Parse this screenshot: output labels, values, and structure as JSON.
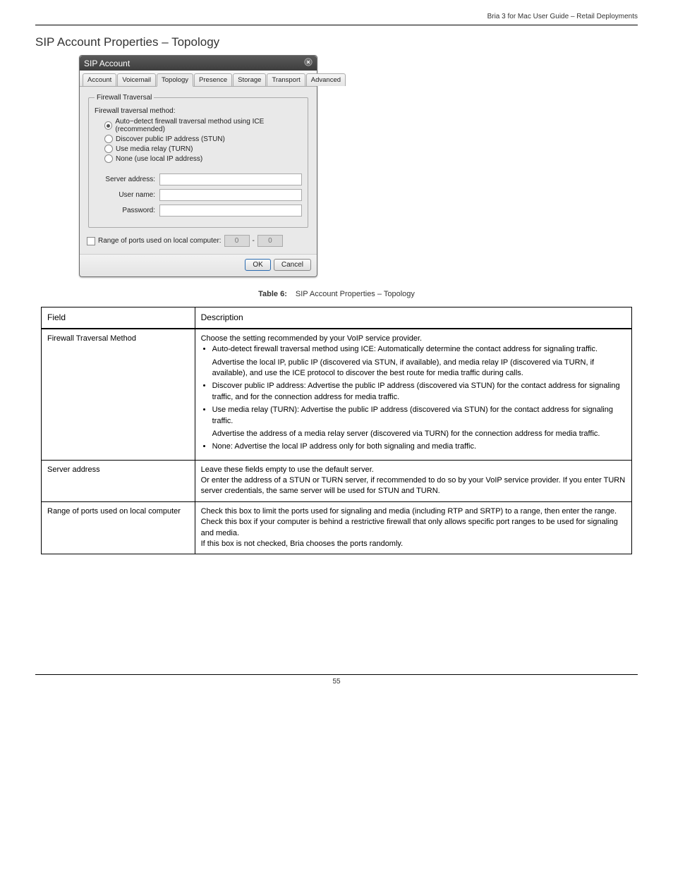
{
  "header": {
    "product": "Bria 3 for Mac User Guide – Retail Deployments"
  },
  "section": {
    "title": "SIP Account Properties – Topology"
  },
  "dialog": {
    "title": "SIP Account",
    "tabs": [
      "Account",
      "Voicemail",
      "Topology",
      "Presence",
      "Storage",
      "Transport",
      "Advanced"
    ],
    "active_tab": "Topology",
    "fieldset_legend": "Firewall Traversal",
    "method_label": "Firewall traversal method:",
    "options": [
      "Auto−detect firewall traversal method using ICE (recommended)",
      "Discover public IP address (STUN)",
      "Use media relay (TURN)",
      "None (use local IP address)"
    ],
    "labels": {
      "server": "Server address:",
      "username": "User name:",
      "password": "Password:"
    },
    "ports_label": "Range of ports used on local computer:",
    "port_from": "0",
    "port_to": "0",
    "ok": "OK",
    "cancel": "Cancel",
    "dash": "-"
  },
  "table": {
    "caption_label": "Table 6:",
    "caption_title": "SIP Account Properties – Topology",
    "columns": [
      "Field",
      "Description"
    ],
    "rows": [
      {
        "field": "Firewall Traversal Method",
        "desc_preamble": "Choose the setting recommended by your VoIP service provider.",
        "desc_bullets": [
          "Auto-detect firewall traversal method using ICE: Automatically determine the contact address for signaling traffic.",
          "Advertise the local IP, public IP (discovered via STUN, if available), and media relay IP (discovered via TURN, if available), and use the ICE protocol to discover the best route for media traffic during calls.",
          "Discover public IP address: Advertise the public IP address (discovered via STUN) for the contact address for signaling traffic, and for the connection address for media traffic.",
          "Use media relay (TURN): Advertise the public IP address (discovered via STUN) for the contact address for signaling traffic.",
          "Advertise the address of a media relay server (discovered via TURN) for the connection address for media traffic.",
          "None: Advertise the local IP address only for both signaling and media traffic."
        ]
      },
      {
        "field": "Server address",
        "desc_preamble": "Leave these fields empty to use the default server.",
        "desc_more": [
          "Or enter the address of a STUN or TURN server, if recommended to do so by your VoIP service provider. If you enter TURN server credentials, the same server will be used for STUN and TURN."
        ]
      },
      {
        "field": "Range of ports used on local computer",
        "desc_preamble": "Check this box to limit the ports used for signaling and media (including RTP and SRTP) to a range, then enter the range.",
        "desc_more": [
          "Check this box if your computer is behind a restrictive firewall that only allows specific port ranges to be used for signaling and media.",
          "If this box is not checked, Bria chooses the ports randomly."
        ]
      }
    ]
  },
  "footer": {
    "page": "55"
  }
}
